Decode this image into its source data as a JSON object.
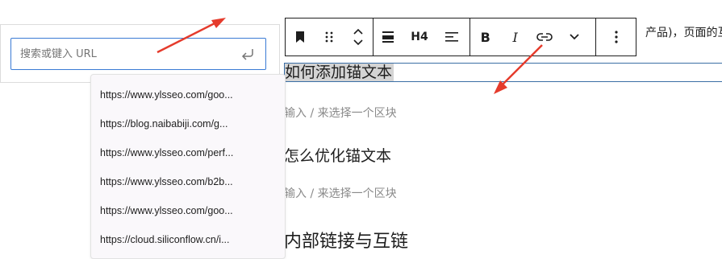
{
  "editor": {
    "paragraph_fragment": "产品)，页面的互",
    "heading_selected": "如何添加锚文本",
    "placeholder_1": "输入 / 来选择一个区块",
    "heading_optimize": "怎么优化锚文本",
    "placeholder_2": "输入 / 来选择一个区块",
    "heading_internal": "内部链接与互链"
  },
  "toolbar": {
    "heading_level": "H4"
  },
  "link_popover": {
    "input_placeholder": "搜索或键入 URL",
    "input_value": ""
  },
  "suggestions": [
    "https://www.ylsseo.com/goo...",
    "https://blog.naibabiji.com/g...",
    "https://www.ylsseo.com/perf...",
    "https://www.ylsseo.com/b2b...",
    "https://www.ylsseo.com/goo...",
    "https://cloud.siliconflow.cn/i..."
  ],
  "colors": {
    "annotation_arrow": "#e53b2c",
    "input_focus": "#3a7bd5",
    "selection_border": "#3a6ea5",
    "selection_fill": "#d4d4d4"
  }
}
